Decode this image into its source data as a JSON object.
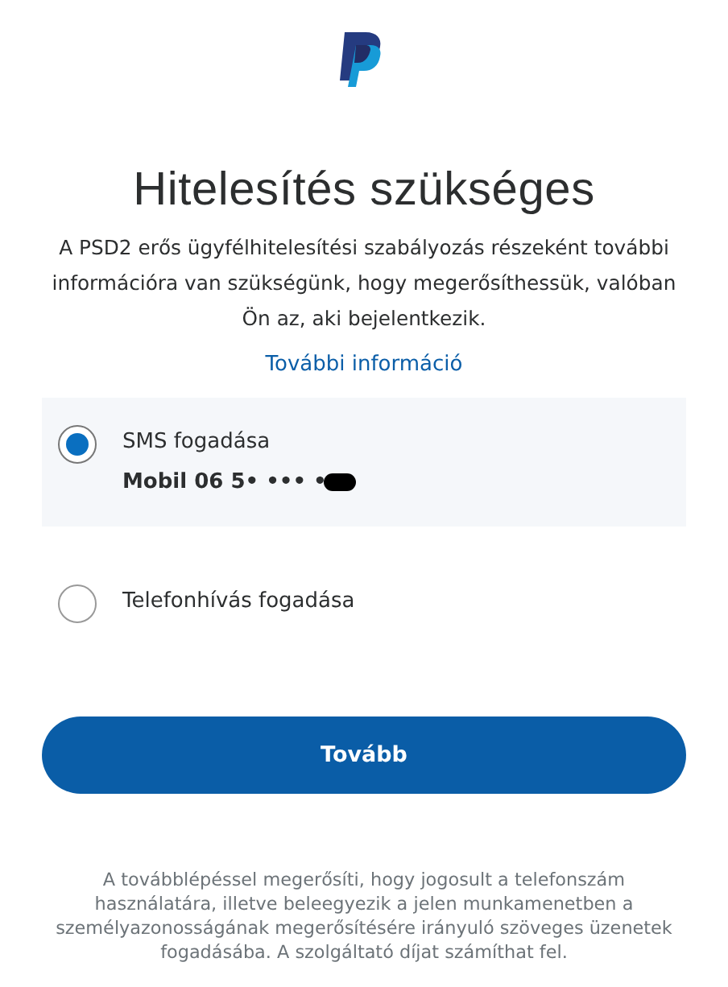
{
  "title": "Hitelesítés szükséges",
  "description": "A PSD2 erős ügyfélhitelesítési szabályozás részeként további információra van szükségünk, hogy megerősíthessük, valóban Ön az, aki bejelentkezik.",
  "more_info_link": "További információ",
  "options": [
    {
      "label": "SMS fogadása",
      "selected": true,
      "detail": "Mobil 06 5• ••• •",
      "redacted": true
    },
    {
      "label": "Telefonhívás fogadása",
      "selected": false
    }
  ],
  "continue_button": "Tovább",
  "footer": "A továbblépéssel megerősíti, hogy jogosult a telefonszám használatára, illetve beleegyezik a jelen munkamenetben a személyazonosságának megerősítésére irányuló szöveges üzenetek fogadásába. A szolgáltató díjat számíthat fel."
}
